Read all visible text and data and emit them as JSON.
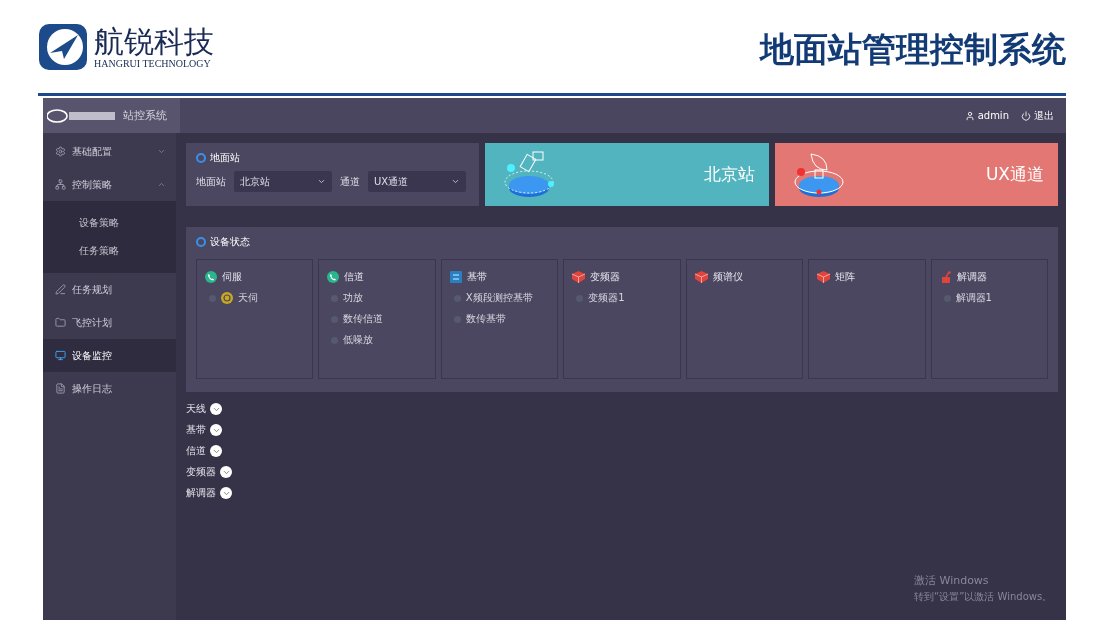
{
  "slide": {
    "logo_name": "航锐科技",
    "logo_subtitle": "HANGRUI TECHNOLOGY",
    "title": "地面站管理控制系统"
  },
  "app": {
    "brand": "站控系统",
    "user": "admin",
    "logout": "退出",
    "sidebar": [
      {
        "label": "基础配置",
        "kind": "gear",
        "expanded": false,
        "selected": false
      },
      {
        "label": "控制策略",
        "kind": "network",
        "expanded": true,
        "selected": false,
        "children": [
          {
            "label": "设备策略"
          },
          {
            "label": "任务策略"
          }
        ]
      },
      {
        "label": "任务规划",
        "kind": "pen",
        "selected": false
      },
      {
        "label": "飞控计划",
        "kind": "folder",
        "selected": false
      },
      {
        "label": "设备监控",
        "kind": "monitor",
        "selected": true
      },
      {
        "label": "操作日志",
        "kind": "doc",
        "selected": false
      }
    ],
    "station_panel": {
      "title": "地面站",
      "fields": [
        {
          "label": "地面站",
          "value": "北京站"
        },
        {
          "label": "通道",
          "value": "UX通道"
        }
      ]
    },
    "banners": [
      {
        "text": "北京站",
        "kind": "satellite",
        "color": "#52b4be"
      },
      {
        "text": "UX通道",
        "kind": "dish",
        "color": "#e27773"
      }
    ],
    "status_panel": {
      "title": "设备状态",
      "groups": [
        {
          "name": "伺服",
          "kind": "dial",
          "color": "#2bb58c",
          "items": [
            {
              "label": "天伺",
              "kind": "badge"
            }
          ]
        },
        {
          "name": "信道",
          "kind": "dial",
          "color": "#2bb58c",
          "items": [
            {
              "label": "功放",
              "kind": "plain"
            },
            {
              "label": "数传信道",
              "kind": "plain"
            },
            {
              "label": "低噪放",
              "kind": "plain"
            }
          ]
        },
        {
          "name": "基带",
          "kind": "board",
          "color": "#2a7fc1",
          "items": [
            {
              "label": "X频段测控基带",
              "kind": "plain"
            },
            {
              "label": "数传基带",
              "kind": "plain"
            }
          ]
        },
        {
          "name": "变频器",
          "kind": "box",
          "color": "#e0443c",
          "items": [
            {
              "label": "变频器1",
              "kind": "plain"
            }
          ]
        },
        {
          "name": "频谱仪",
          "kind": "box",
          "color": "#e0443c"
        },
        {
          "name": "矩阵",
          "kind": "box",
          "color": "#e0443c"
        },
        {
          "name": "解调器",
          "kind": "robot",
          "color": "#e0443c",
          "items": [
            {
              "label": "解调器1",
              "kind": "plain"
            }
          ]
        }
      ]
    },
    "sections": [
      {
        "label": "天线",
        "expanded": false
      },
      {
        "label": "基带",
        "expanded": false
      },
      {
        "label": "信道",
        "expanded": false
      },
      {
        "label": "变频器",
        "expanded": false
      },
      {
        "label": "解调器",
        "expanded": false
      }
    ],
    "notice": {
      "title": "激活 Windows",
      "text": "转到“设置”以激活 Windows。"
    }
  }
}
